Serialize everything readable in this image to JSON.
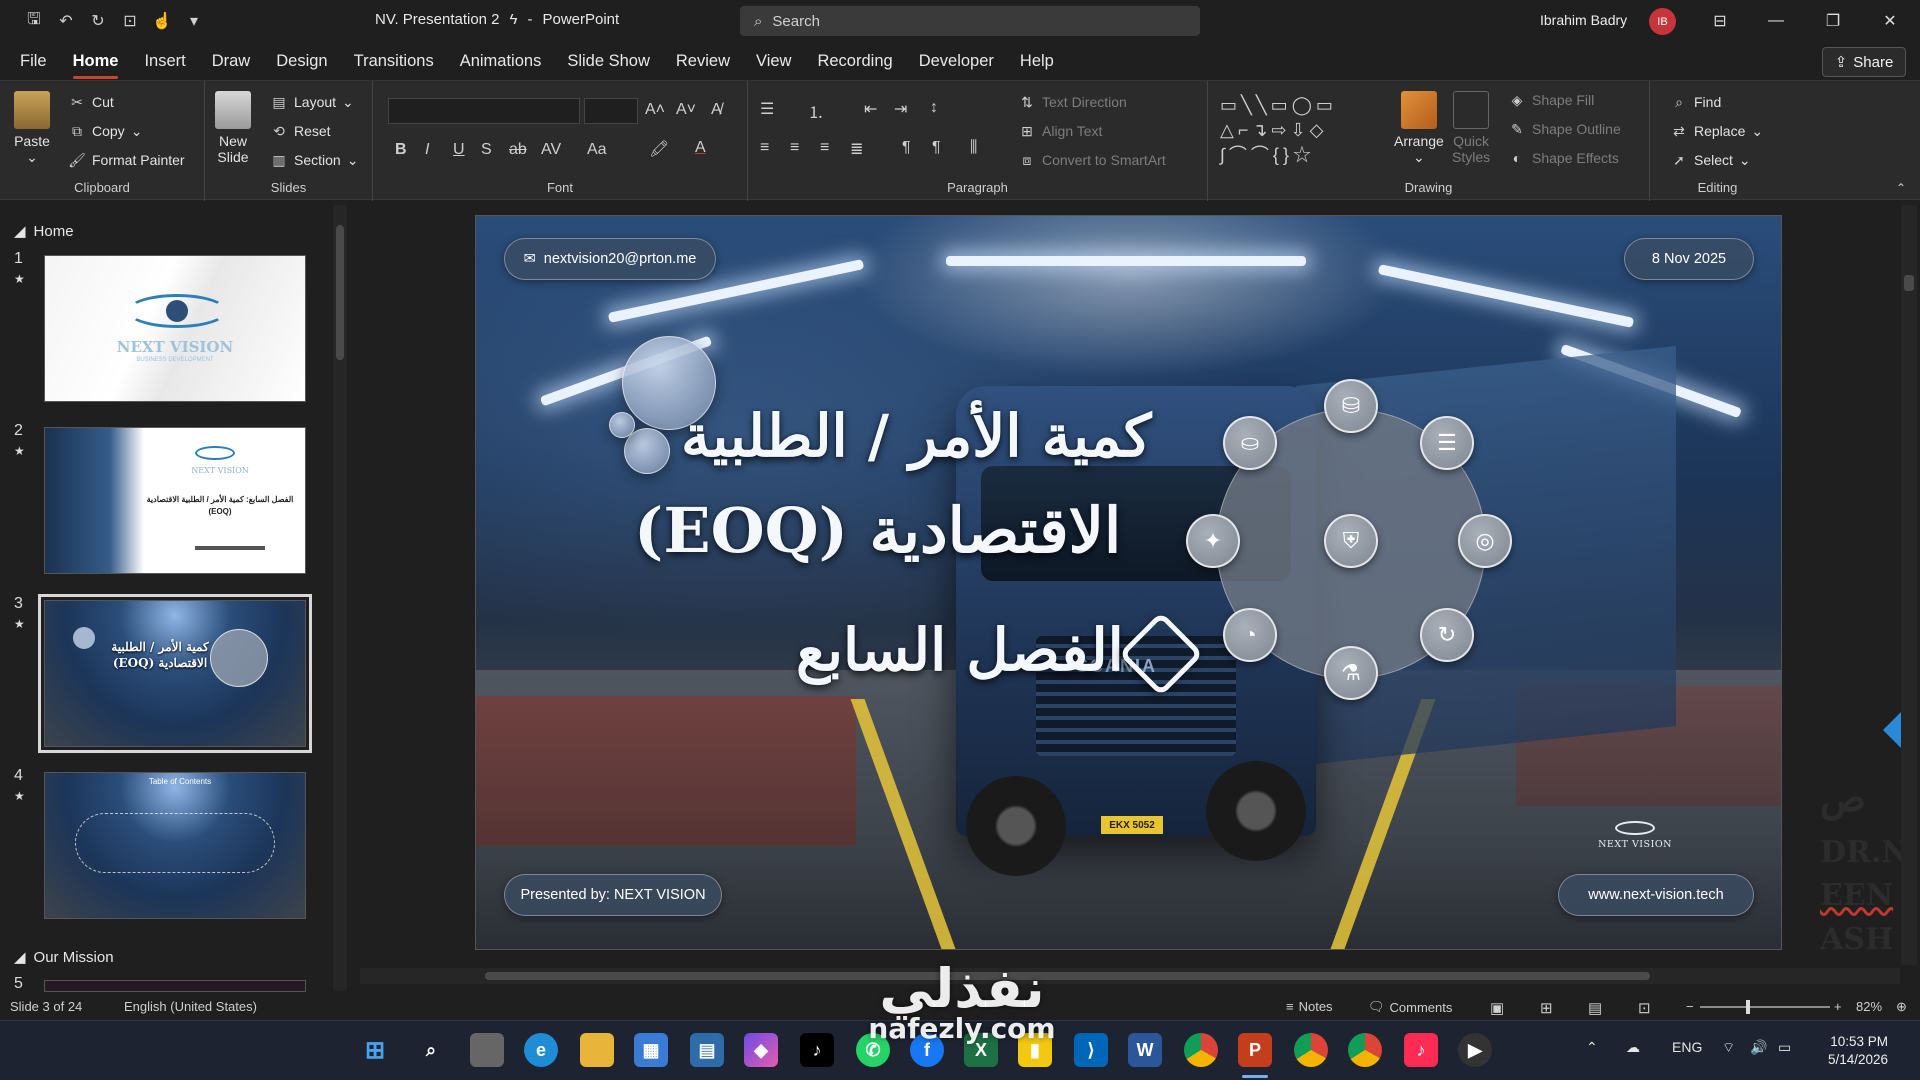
{
  "app": {
    "doc_name": "NV. Presentation 2",
    "app_name": "PowerPoint",
    "search_placeholder": "Search",
    "user_name": "Ibrahim Badry",
    "user_initials": "IB"
  },
  "menu": {
    "tabs": [
      "File",
      "Home",
      "Insert",
      "Draw",
      "Design",
      "Transitions",
      "Animations",
      "Slide Show",
      "Review",
      "View",
      "Recording",
      "Developer",
      "Help"
    ],
    "active_tab": "Home",
    "share_label": "Share"
  },
  "ribbon": {
    "clipboard": {
      "label": "Clipboard",
      "paste": "Paste",
      "cut": "Cut",
      "copy": "Copy",
      "format_painter": "Format Painter"
    },
    "slides": {
      "label": "Slides",
      "new_slide_1": "New",
      "new_slide_2": "Slide",
      "layout": "Layout",
      "reset": "Reset",
      "section": "Section"
    },
    "font": {
      "label": "Font"
    },
    "paragraph": {
      "label": "Paragraph",
      "text_direction": "Text Direction",
      "align_text": "Align Text",
      "convert_smartart": "Convert to SmartArt"
    },
    "drawing": {
      "label": "Drawing",
      "arrange": "Arrange",
      "quick_1": "Quick",
      "quick_2": "Styles",
      "shape_fill": "Shape Fill",
      "shape_outline": "Shape Outline",
      "shape_effects": "Shape Effects"
    },
    "editing": {
      "label": "Editing",
      "find": "Find",
      "replace": "Replace",
      "select": "Select"
    }
  },
  "thumbnails": {
    "section_home": "Home",
    "section_mission": "Our Mission",
    "slides": [
      {
        "num": "1",
        "star": "★",
        "logo": "NEXT VISION",
        "sub": "BUSINESS DEVELOPMENT"
      },
      {
        "num": "2",
        "star": "★",
        "logo": "NEXT VISION",
        "title": "الفصل السابع: كمية الأمر / الطلبية الاقتصادية (EOQ)"
      },
      {
        "num": "3",
        "star": "★",
        "title": "كمية الأمر / الطلبية الاقتصادية (EOQ)"
      },
      {
        "num": "4",
        "star": "★",
        "title": "Table of Contents"
      }
    ],
    "next_num": "5"
  },
  "slide": {
    "email": "nextvision20@prton.me",
    "date": "8 Nov 2025",
    "title_line1": "كمية الأمر / الطلبية",
    "title_line2": "الاقتصادية (EOQ)",
    "title_line3": "الفصل السابع",
    "presented_by": "Presented by: NEXT VISION",
    "website": "www.next-vision.tech",
    "logo_text": "NEXT VISION",
    "plate": "EKX 5052",
    "brand": "SCANIA"
  },
  "right_peek": {
    "line1": "ص",
    "line2": "DR.N",
    "line3": "EEN",
    "line4": "ASH"
  },
  "status": {
    "slide_info": "Slide 3 of 24",
    "language": "English (United States)",
    "notes": "Notes",
    "comments": "Comments",
    "zoom": "82%"
  },
  "taskbar": {
    "lang": "ENG",
    "time": "10:53 PM",
    "date": "5/14/2026"
  },
  "watermark": {
    "arabic": "نفذلي",
    "latin": "nafezly.com"
  },
  "colors": {
    "accent": "#c5452f",
    "avatar": "#c8343c",
    "slide_blue": "#1c3558"
  }
}
